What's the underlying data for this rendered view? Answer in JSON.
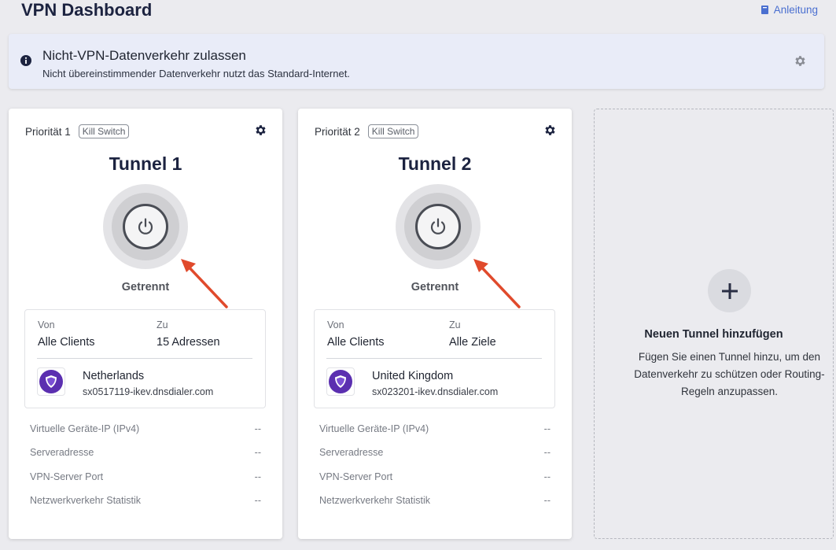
{
  "header": {
    "title": "VPN Dashboard",
    "manual_label": "Anleitung"
  },
  "banner": {
    "title": "Nicht-VPN-Datenverkehr zulassen",
    "subtitle": "Nicht übereinstimmender Datenverkehr nutzt das Standard-Internet."
  },
  "tunnels": [
    {
      "priority": "Priorität 1",
      "badge": "Kill Switch",
      "name": "Tunnel 1",
      "status": "Getrennt",
      "from_label": "Von",
      "from_value": "Alle Clients",
      "to_label": "Zu",
      "to_value": "15 Adressen",
      "country": "Netherlands",
      "server": "sx0517119-ikev.dnsdialer.com",
      "stats": [
        {
          "label": "Virtuelle Geräte-IP (IPv4)",
          "value": "--"
        },
        {
          "label": "Serveradresse",
          "value": "--"
        },
        {
          "label": "VPN-Server Port",
          "value": "--"
        },
        {
          "label": "Netzwerkverkehr Statistik",
          "value": "--"
        }
      ]
    },
    {
      "priority": "Priorität 2",
      "badge": "Kill Switch",
      "name": "Tunnel 2",
      "status": "Getrennt",
      "from_label": "Von",
      "from_value": "Alle Clients",
      "to_label": "Zu",
      "to_value": "Alle Ziele",
      "country": "United Kingdom",
      "server": "sx023201-ikev.dnsdialer.com",
      "stats": [
        {
          "label": "Virtuelle Geräte-IP (IPv4)",
          "value": "--"
        },
        {
          "label": "Serveradresse",
          "value": "--"
        },
        {
          "label": "VPN-Server Port",
          "value": "--"
        },
        {
          "label": "Netzwerkverkehr Statistik",
          "value": "--"
        }
      ]
    }
  ],
  "add_tunnel": {
    "title": "Neuen Tunnel hinzufügen",
    "description": "Fügen Sie einen Tunnel hinzu, um den Datenverkehr zu schützen oder Routing-Regeln anzupassen."
  },
  "colors": {
    "accent": "#4a6fd0",
    "arrow": "#e04a2c",
    "shield": "#5b2fb0"
  },
  "icons": [
    "book-icon",
    "info-icon",
    "gear-icon",
    "power-icon",
    "shield-icon",
    "plus-icon"
  ]
}
